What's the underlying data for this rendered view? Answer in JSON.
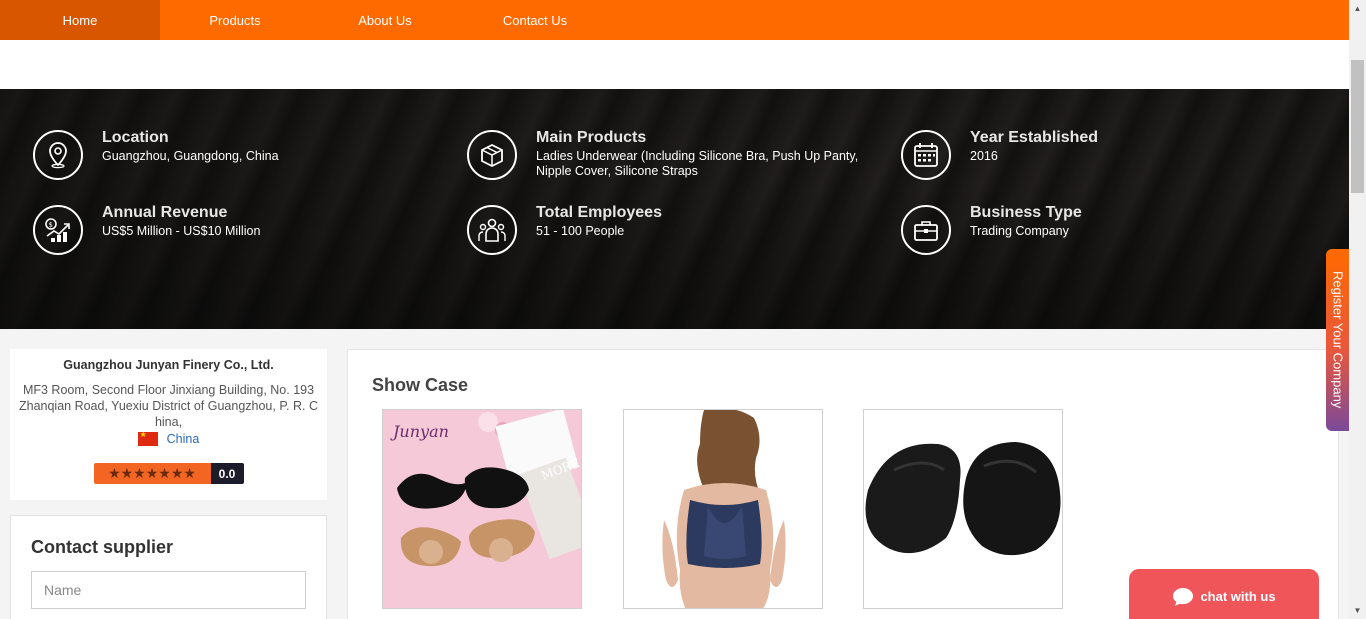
{
  "nav": {
    "items": [
      {
        "label": "Home",
        "active": true
      },
      {
        "label": "Products",
        "active": false
      },
      {
        "label": "About Us",
        "active": false
      },
      {
        "label": "Contact Us",
        "active": false
      }
    ]
  },
  "facts": {
    "location": {
      "title": "Location",
      "value": "Guangzhou, Guangdong, China",
      "icon": "map-pin-icon"
    },
    "main_products": {
      "title": "Main Products",
      "value": "Ladies Underwear (Including Silicone Bra, Push Up Panty, Nipple Cover, Silicone Straps",
      "icon": "box-icon"
    },
    "year_established": {
      "title": "Year Established",
      "value": "2016",
      "icon": "calendar-icon"
    },
    "annual_revenue": {
      "title": "Annual Revenue",
      "value": "US$5 Million - US$10 Million",
      "icon": "revenue-chart-icon"
    },
    "total_employees": {
      "title": "Total Employees",
      "value": "51 - 100 People",
      "icon": "people-icon"
    },
    "business_type": {
      "title": "Business Type",
      "value": "Trading Company",
      "icon": "briefcase-icon"
    }
  },
  "company": {
    "name": "Guangzhou Junyan Finery Co., Ltd.",
    "address": "MF3 Room, Second Floor Jinxiang Building, No. 193 Zhanqian Road, Yuexiu District of Guangzhou, P. R. China,",
    "country": "China",
    "rating_stars": "★★★★★★★",
    "rating_score": "0.0"
  },
  "contact": {
    "title": "Contact supplier",
    "name_placeholder": "Name",
    "name_value": ""
  },
  "showcase": {
    "title": "Show Case",
    "products": [
      {
        "brand_text": "Junyan",
        "decor_text": "MORE"
      },
      {
        "brand_text": ""
      },
      {
        "brand_text": ""
      }
    ]
  },
  "side_tab": {
    "label": "Register Your Company"
  },
  "chat": {
    "label": "chat with us"
  },
  "colors": {
    "accent": "#ff6a00",
    "nav_active": "#d95600",
    "chat": "#f0555a",
    "link": "#2b6ab7"
  }
}
